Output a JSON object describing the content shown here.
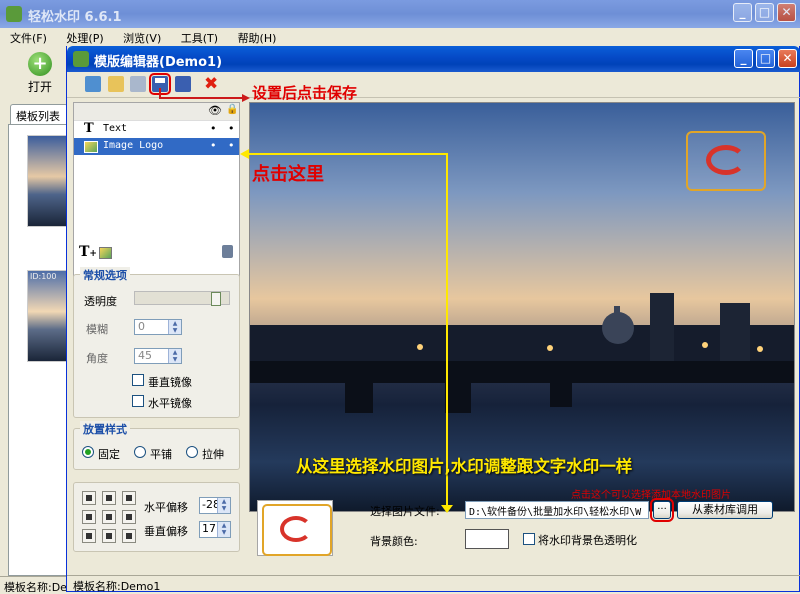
{
  "main_window": {
    "title": "轻松水印 6.6.1",
    "menu": [
      "文件(F)",
      "处理(P)",
      "浏览(V)",
      "工具(T)",
      "帮助(H)"
    ],
    "toolbar": {
      "open_label": "打开"
    },
    "tab_label": "模板列表",
    "thumb_caption": "ID:100",
    "status": "模板名称:De"
  },
  "editor": {
    "title": "模版编辑器(Demo1)",
    "layers": [
      {
        "name": "Text",
        "icon": "text-T-icon"
      },
      {
        "name": "Image Logo",
        "icon": "image-icon",
        "selected": true
      }
    ],
    "general": {
      "label": "常规选项",
      "opacity_label": "透明度",
      "opacity_percent": 88,
      "blur_label": "模糊",
      "blur_value": "0",
      "angle_label": "角度",
      "angle_value": "45",
      "vertical_mirror": "垂直镜像",
      "horizontal_mirror": "水平镜像"
    },
    "placement": {
      "label": "放置样式",
      "options": [
        "固定",
        "平铺",
        "拉伸"
      ],
      "selected": "固定"
    },
    "offset": {
      "h_label": "水平偏移",
      "h_value": "-28",
      "v_label": "垂直偏移",
      "v_value": "17"
    },
    "file": {
      "choose_label": "选择图片文件:",
      "path": "D:\\软件备份\\批量加水印\\轻松水印\\W",
      "browse_label": "···",
      "library_button": "从素材库调用",
      "bg_label": "背景颜色:",
      "transparent_label": "将水印背景色透明化"
    },
    "status": "模板名称:Demo1"
  },
  "annotations": {
    "save_hint": "设置后点击保存",
    "click_here": "点击这里",
    "choose_hint": "从这里选择水印图片,水印调整跟文字水印一样",
    "local_hint": "点击这个可以选择添加本地水印图片"
  },
  "colors": {
    "annotation": "#e00000",
    "arrow": "#ffea00",
    "accent": "#316ac5"
  }
}
